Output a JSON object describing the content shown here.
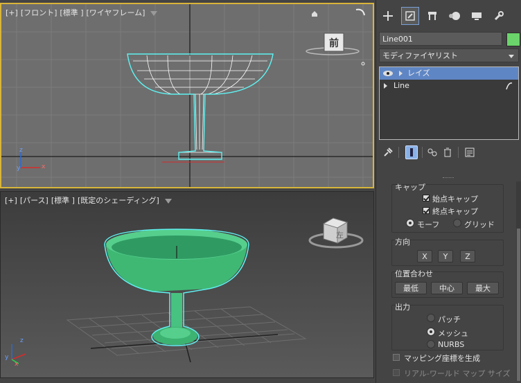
{
  "viewport_front": {
    "plus": "[+]",
    "view": "[フロント]",
    "mode": "[標準 ]",
    "shading": "[ワイヤフレーム]",
    "viewcube_label": "前"
  },
  "viewport_persp": {
    "plus": "[+]",
    "view": "[パース]",
    "mode": "[標準 ]",
    "shading": "[既定のシェーディング]",
    "viewcube_label": "左"
  },
  "axes": {
    "x": "x",
    "y": "y",
    "z": "z"
  },
  "panel": {
    "tabs": [
      "create-icon",
      "modify-icon",
      "hierarchy-icon",
      "motion-icon",
      "display-icon",
      "utilities-icon"
    ],
    "object_name": "Line001",
    "object_color": "#6bd46b",
    "modifier_list": "モディファイヤリスト",
    "stack": [
      {
        "label": "レイズ",
        "selected": true
      },
      {
        "label": "Line",
        "selected": false
      }
    ],
    "caps": {
      "title": "キャップ",
      "start_cap": "始点キャップ",
      "end_cap": "終点キャップ",
      "morph": "モーフ",
      "grid": "グリッド"
    },
    "direction": {
      "title": "方向",
      "x": "X",
      "y": "Y",
      "z": "Z"
    },
    "align": {
      "title": "位置合わせ",
      "min": "最低",
      "center": "中心",
      "max": "最大"
    },
    "output": {
      "title": "出力",
      "patch": "パッチ",
      "mesh": "メッシュ",
      "nurbs": "NURBS"
    },
    "gen_mapping": "マッピング座標を生成",
    "real_world": "リアル-ワールド マップ サイズ"
  }
}
